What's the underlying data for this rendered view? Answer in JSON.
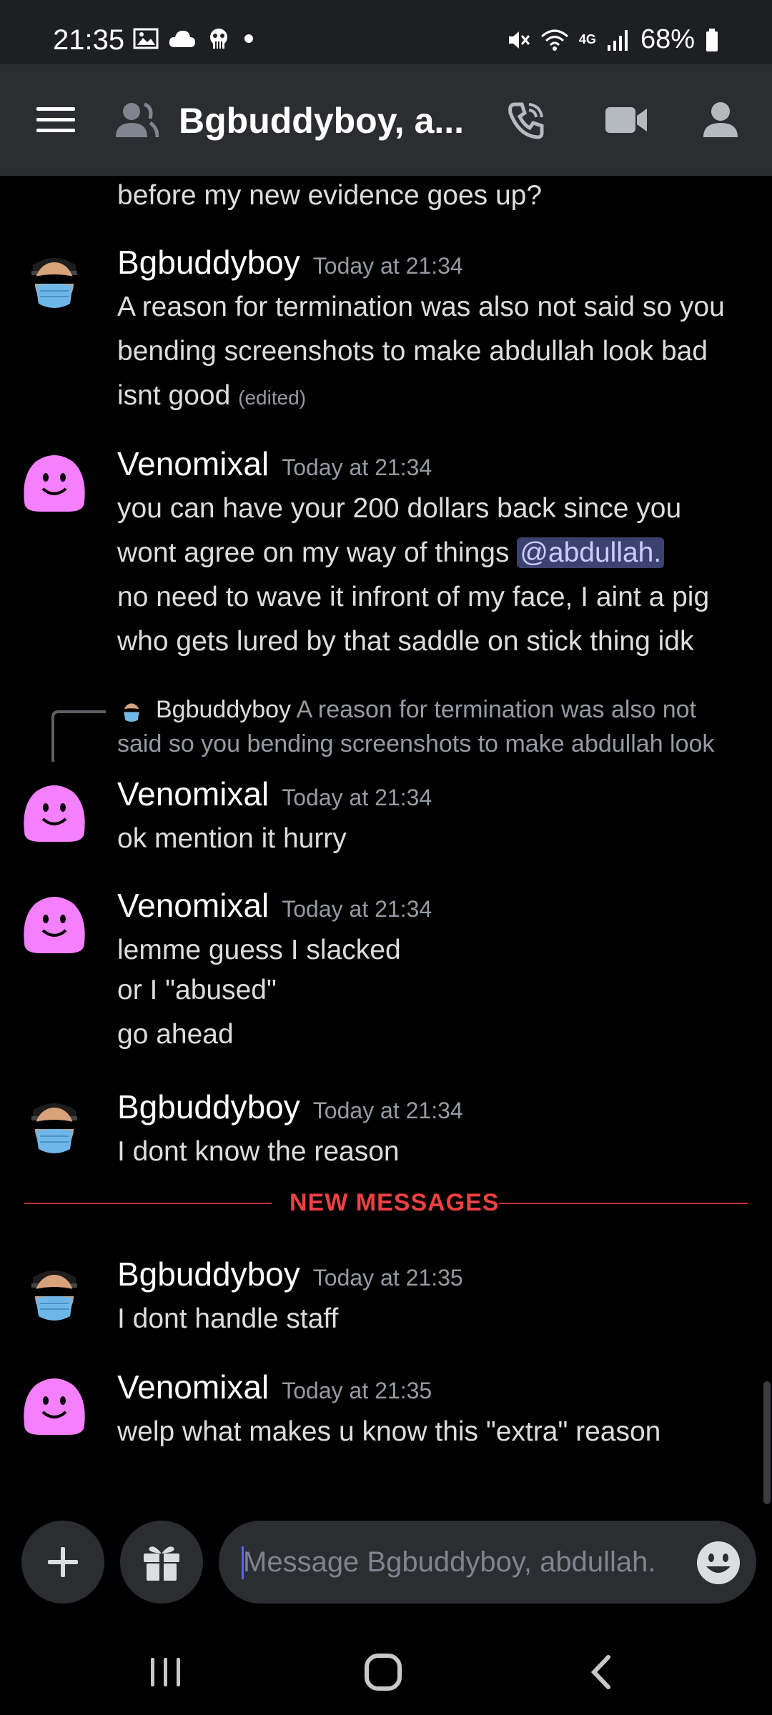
{
  "status_bar": {
    "time": "21:35",
    "battery": "68%",
    "network": "4G",
    "icons_left": [
      "image-icon",
      "cloud-icon",
      "app-notification-icon",
      "dot-icon"
    ],
    "icons_right": [
      "mute-icon",
      "wifi-icon",
      "4g-icon",
      "signal-icon",
      "battery-icon"
    ]
  },
  "header": {
    "title": "Bgbuddyboy, a...",
    "icons": [
      "menu-icon",
      "group-dm-icon",
      "call-icon",
      "video-icon",
      "members-icon"
    ]
  },
  "chat": {
    "partial_line": "before my new evidence goes up?",
    "messages": [
      {
        "author": "Bgbuddyboy",
        "time": "Today at 21:34",
        "lines": [
          "A reason for termination was also not said so you",
          "bending screenshots to make abdullah look bad",
          "isnt good"
        ],
        "edited": "(edited)"
      },
      {
        "author": "Venomixal",
        "time": "Today at 21:34",
        "lines": [
          "you can have your 200 dollars back since you",
          "wont agree on my way of things",
          "no need to wave it infront of my face, I aint a pig",
          "who gets lured by that saddle on stick thing idk"
        ],
        "mention": "@abdullah."
      },
      {
        "reply": {
          "author": "Bgbuddyboy",
          "line1": "A reason for termination was also not",
          "line2": "said so you bending screenshots to make abdullah look"
        },
        "author": "Venomixal",
        "time": "Today at 21:34",
        "lines": [
          "ok mention it hurry"
        ]
      },
      {
        "author": "Venomixal",
        "time": "Today at 21:34",
        "lines": [
          "lemme guess I slacked",
          "or I \"abused\"",
          "go ahead"
        ]
      },
      {
        "author": "Bgbuddyboy",
        "time": "Today at 21:34",
        "lines": [
          "I dont know the reason"
        ]
      },
      {
        "author": "Bgbuddyboy",
        "time": "Today at 21:35",
        "lines": [
          "I dont handle staff"
        ]
      },
      {
        "author": "Venomixal",
        "time": "Today at 21:35",
        "lines": [
          "welp what makes u know this \"extra\" reason"
        ]
      }
    ],
    "new_messages_label": "NEW MESSAGES"
  },
  "input_bar": {
    "placeholder": "Message Bgbuddyboy, abdullah.",
    "icons": [
      "plus-icon",
      "gift-icon",
      "emoji-icon"
    ]
  },
  "nav_bar": {
    "icons": [
      "recent-apps-icon",
      "home-icon",
      "back-icon"
    ]
  },
  "colors": {
    "background": "#000000",
    "header": "#2b2d31",
    "new_messages": "#f23f43",
    "mention_bg": "#3c4270",
    "venomixal_avatar": "#f47fff"
  }
}
